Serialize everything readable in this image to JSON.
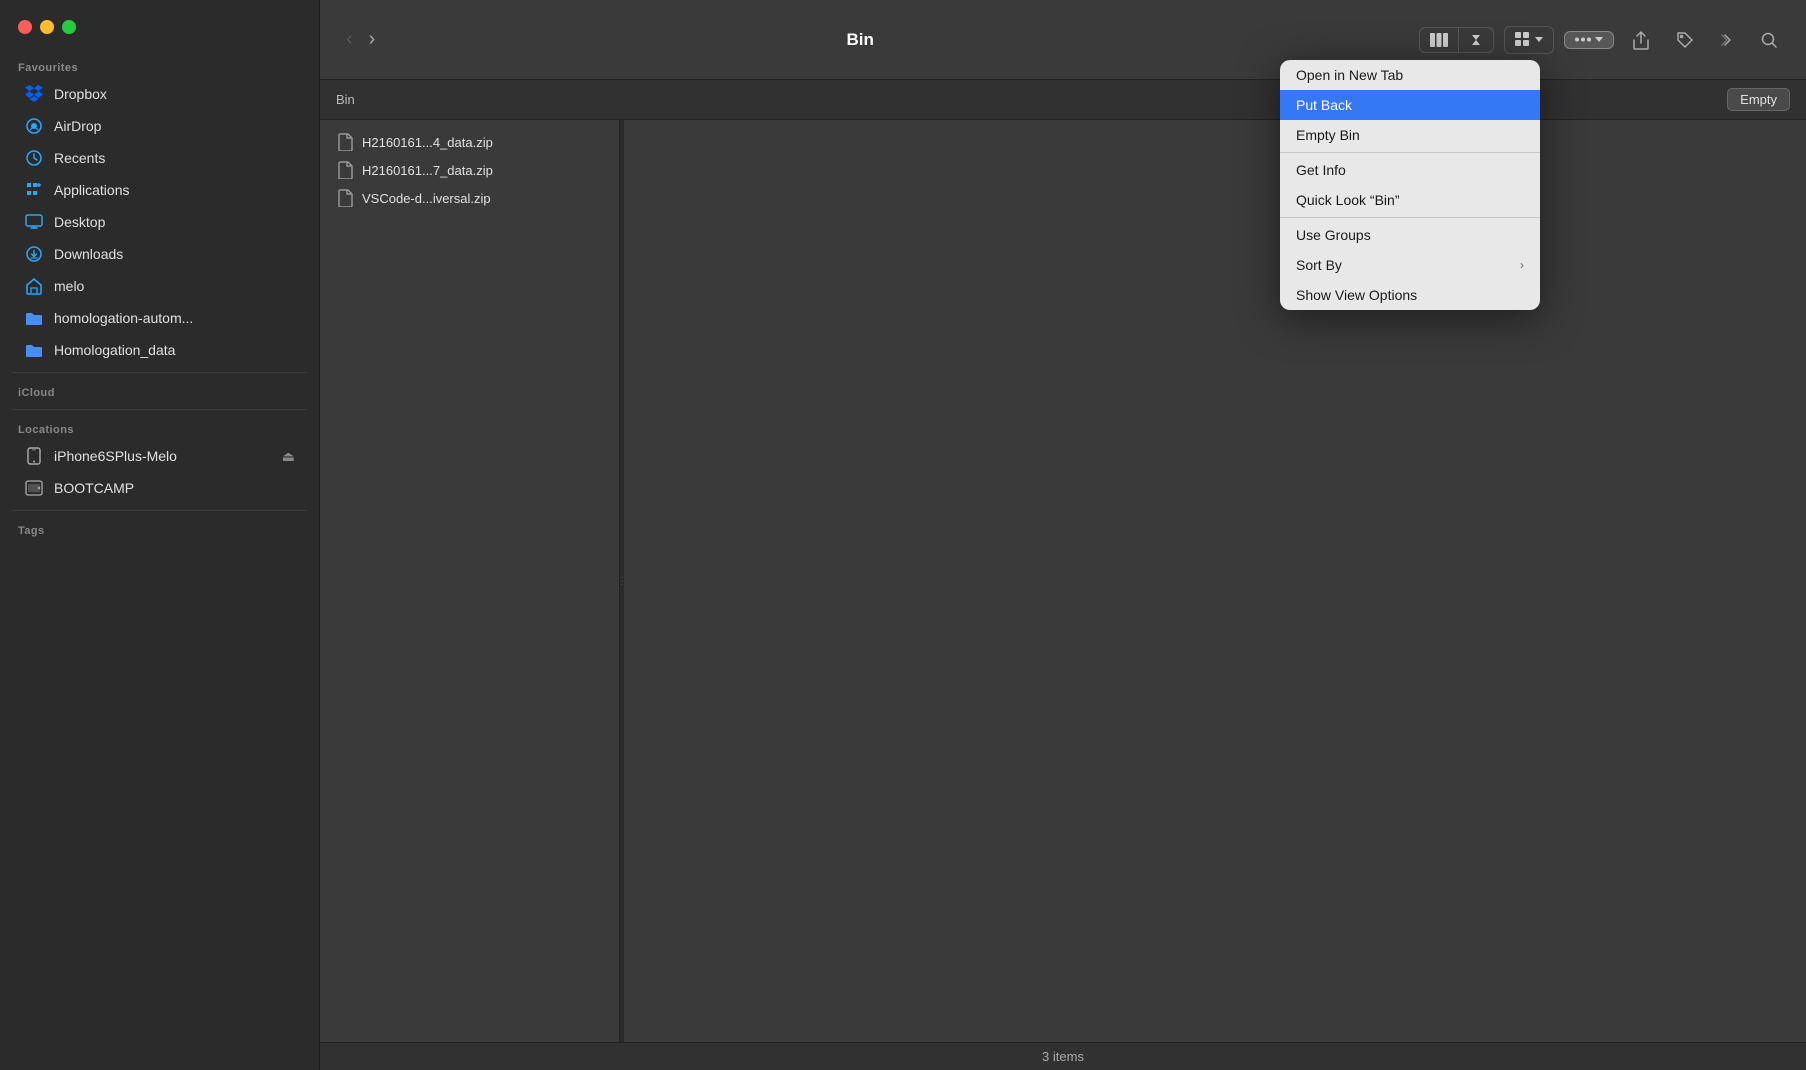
{
  "window": {
    "title": "Bin"
  },
  "trafficLights": {
    "close": "close",
    "minimize": "minimize",
    "maximize": "maximize"
  },
  "sidebar": {
    "favourites_label": "Favourites",
    "icloud_label": "iCloud",
    "locations_label": "Locations",
    "tags_label": "Tags",
    "items": [
      {
        "id": "dropbox",
        "label": "Dropbox",
        "icon": "dropbox"
      },
      {
        "id": "airdrop",
        "label": "AirDrop",
        "icon": "airdrop"
      },
      {
        "id": "recents",
        "label": "Recents",
        "icon": "recents"
      },
      {
        "id": "applications",
        "label": "Applications",
        "icon": "applications"
      },
      {
        "id": "desktop",
        "label": "Desktop",
        "icon": "desktop"
      },
      {
        "id": "downloads",
        "label": "Downloads",
        "icon": "downloads"
      },
      {
        "id": "melo",
        "label": "melo",
        "icon": "home"
      },
      {
        "id": "homologation-autom",
        "label": "homologation-autom...",
        "icon": "folder"
      },
      {
        "id": "homologation-data",
        "label": "Homologation_data",
        "icon": "folder"
      }
    ],
    "locations": [
      {
        "id": "iphone",
        "label": "iPhone6SPlus-Melo",
        "icon": "iphone",
        "eject": true
      },
      {
        "id": "bootcamp",
        "label": "BOOTCAMP",
        "icon": "drive",
        "eject": false
      }
    ]
  },
  "toolbar": {
    "back_label": "‹",
    "forward_label": "›",
    "title": "Bin",
    "empty_button": "Empty"
  },
  "breadcrumb": {
    "path": "Bin"
  },
  "files": [
    {
      "name": "H2160161...4_data.zip",
      "type": "zip"
    },
    {
      "name": "H2160161...7_data.zip",
      "type": "zip"
    },
    {
      "name": "VSCode-d...iversal.zip",
      "type": "zip"
    }
  ],
  "status": {
    "items": "3 items"
  },
  "contextMenu": {
    "items": [
      {
        "id": "open-new-tab",
        "label": "Open in New Tab",
        "highlighted": false,
        "arrow": false,
        "divider_after": false
      },
      {
        "id": "put-back",
        "label": "Put Back",
        "highlighted": true,
        "arrow": false,
        "divider_after": false
      },
      {
        "id": "empty-bin",
        "label": "Empty Bin",
        "highlighted": false,
        "arrow": false,
        "divider_after": true
      },
      {
        "id": "get-info",
        "label": "Get Info",
        "highlighted": false,
        "arrow": false,
        "divider_after": false
      },
      {
        "id": "quick-look",
        "label": "Quick Look “Bin”",
        "highlighted": false,
        "arrow": false,
        "divider_after": true
      },
      {
        "id": "use-groups",
        "label": "Use Groups",
        "highlighted": false,
        "arrow": false,
        "divider_after": false
      },
      {
        "id": "sort-by",
        "label": "Sort By",
        "highlighted": false,
        "arrow": true,
        "divider_after": false
      },
      {
        "id": "show-view-options",
        "label": "Show View Options",
        "highlighted": false,
        "arrow": false,
        "divider_after": false
      }
    ]
  }
}
